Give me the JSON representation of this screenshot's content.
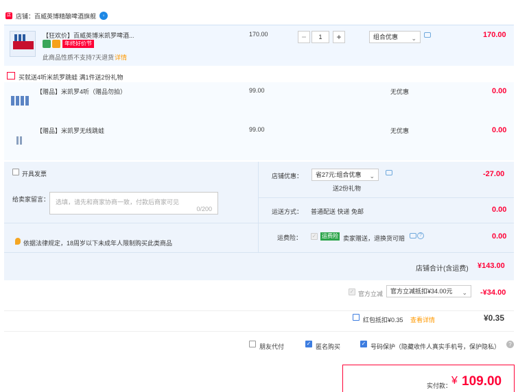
{
  "store": {
    "icon": "store-icon",
    "label": "店铺：百威英博精酿啤酒旗舰",
    "chat_icon": "chat-bubble-icon"
  },
  "item": {
    "title": "【狂欢价】百威英博米凯罗啤酒...",
    "promo_tag": "年终好价节",
    "no_return": "此商品性质不支持7天退货",
    "detail_link": "详情",
    "price": "170.00",
    "quantity": "1",
    "minus": "−",
    "plus": "+",
    "discount_select": "组合优惠",
    "subtotal": "170.00"
  },
  "gift_header": "买就送4听米凯罗跳蛙  满1件送2份礼物",
  "gifts": [
    {
      "title": "【赠品】米凯罗4听（赠品勿拍）",
      "price": "99.00",
      "discount": "无优惠",
      "subtotal": "0.00"
    },
    {
      "title": "【赠品】米凯罗无线跳蛙",
      "price": "99.00",
      "discount": "无优惠",
      "subtotal": "0.00"
    }
  ],
  "panel": {
    "invoice_label": "开具发票",
    "message_label": "给卖家留言：",
    "message_placeholder": "选填，请先和商家协商一致，付款后商家可见",
    "message_count": "0/200",
    "legal_notice": "依据法律规定，18周岁以下未成年人限制购买此类商品",
    "store_discount_label": "店铺优惠：",
    "store_discount_select": "省27元:组合优惠",
    "store_discount_gift": "送2份礼物",
    "store_discount_value": "-27.00",
    "shipping_label": "运送方式：",
    "shipping_value": "普通配送 快递 免邮",
    "shipping_fee": "0.00",
    "insurance_label": "运费险：",
    "insurance_tag": "运费险",
    "insurance_text": "卖家赠送，退换货可赔",
    "insurance_fee": "0.00"
  },
  "store_total": {
    "label": "店铺合计(含运费)",
    "value": "¥143.00"
  },
  "official": {
    "label": "官方立减",
    "select": "官方立减抵扣¥34.00元",
    "value": "-¥34.00"
  },
  "redpacket": {
    "label": "红包抵扣¥0.35",
    "link": "查看详情",
    "value": "¥0.35"
  },
  "options": {
    "friend_pay": "朋友代付",
    "anonymous": "匿名购买",
    "privacy": "号码保护（隐藏收件人真实手机号，保护隐私）"
  },
  "final": {
    "label": "实付款：",
    "currency": "¥",
    "amount": "109.00"
  },
  "colors": {
    "accent": "#ff0036",
    "link": "#ff9900",
    "panel": "#eef4fc"
  }
}
